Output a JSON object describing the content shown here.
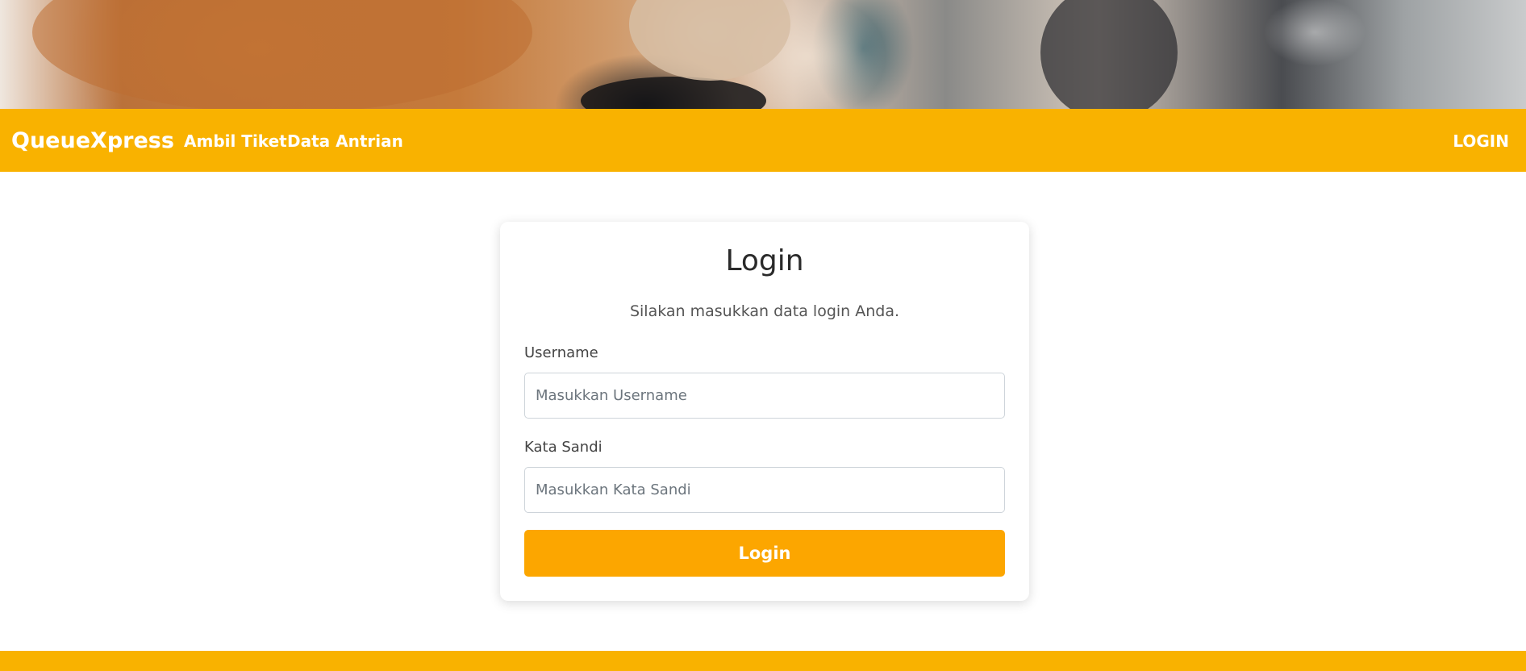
{
  "navbar": {
    "brand": "QueueXpress",
    "links": [
      "Ambil Tiket",
      "Data Antrian"
    ],
    "login_label": "LOGIN"
  },
  "login_card": {
    "title": "Login",
    "subtitle": "Silakan masukkan data login Anda.",
    "username": {
      "label": "Username",
      "placeholder": "Masukkan Username",
      "value": ""
    },
    "password": {
      "label": "Kata Sandi",
      "placeholder": "Masukkan Kata Sandi",
      "value": ""
    },
    "submit_label": "Login"
  },
  "colors": {
    "accent": "#f9b200",
    "button": "#fca600"
  }
}
